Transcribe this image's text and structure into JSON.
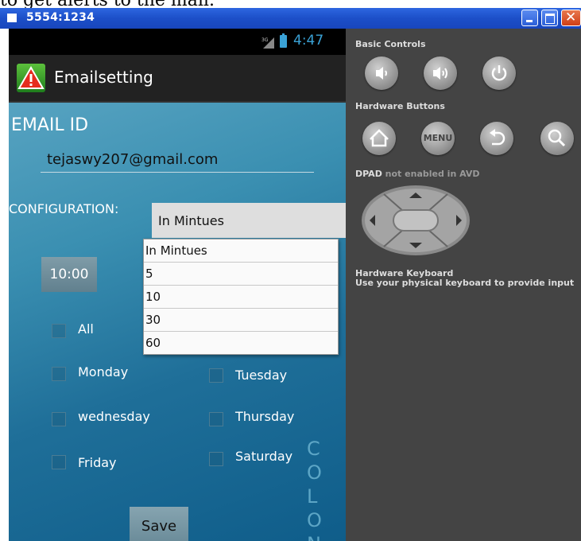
{
  "page": {
    "top_text": "to get alerts to the mail."
  },
  "window": {
    "title": "5554:1234"
  },
  "status_bar": {
    "network": "3G",
    "time": "4:47"
  },
  "app": {
    "title": "Emailsetting"
  },
  "form": {
    "email_label": "EMAIL ID",
    "email_value": "tejaswy207@gmail.com",
    "config_label": "CONFIGURATION:",
    "spinner_value": "In Mintues",
    "dropdown_options": [
      "In Mintues",
      "5",
      "10",
      "30",
      "60"
    ],
    "time_button": "10:00",
    "days": {
      "all": "All",
      "monday": "Monday",
      "tuesday": "Tuesday",
      "wednesday": "wednesday",
      "thursday": "Thursday",
      "friday": "Friday",
      "saturday": "Saturday"
    },
    "save_button": "Save"
  },
  "emulator_panel": {
    "basic_controls": "Basic Controls",
    "hardware_buttons": "Hardware Buttons",
    "menu_label": "MENU",
    "dpad_label": "DPAD",
    "dpad_note": "not enabled in AVD",
    "keyboard_title": "Hardware Keyboard",
    "keyboard_note": "Use your physical keyboard to provide input"
  }
}
